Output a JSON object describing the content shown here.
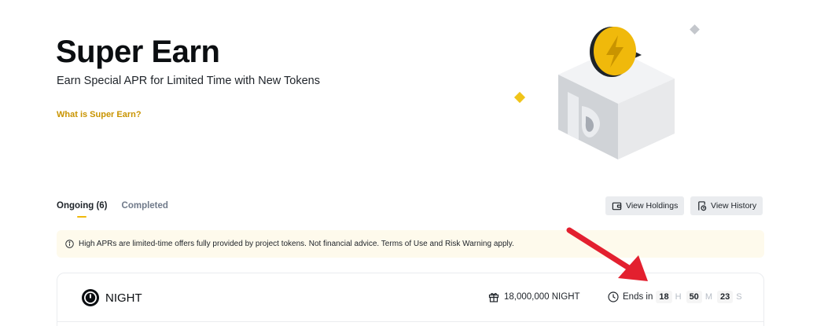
{
  "hero": {
    "title": "Super Earn",
    "subtitle": "Earn Special APR for Limited Time with New Tokens",
    "link": "What is Super Earn?"
  },
  "tabs": [
    {
      "label": "Ongoing (6)",
      "active": true
    },
    {
      "label": "Completed",
      "active": false
    }
  ],
  "actions": {
    "holdings_label": "View Holdings",
    "history_label": "View History"
  },
  "notice": {
    "icon": "info-icon",
    "text": "High APRs are limited-time offers fully provided by project tokens. Not financial advice. Terms of Use and Risk Warning apply."
  },
  "card": {
    "token_name": "NIGHT",
    "token_icon": "night-token-logo",
    "supply": "18,000,000 NIGHT",
    "supply_icon": "gift-icon",
    "countdown": {
      "icon": "clock-icon",
      "label": "Ends in",
      "hours": "18",
      "hours_unit": "H",
      "minutes": "50",
      "minutes_unit": "M",
      "seconds": "23",
      "seconds_unit": "S"
    }
  },
  "colors": {
    "accent": "#f0b90b",
    "link": "#c99400",
    "notice_bg": "#fefaec",
    "annotation_arrow": "#e3202f"
  }
}
